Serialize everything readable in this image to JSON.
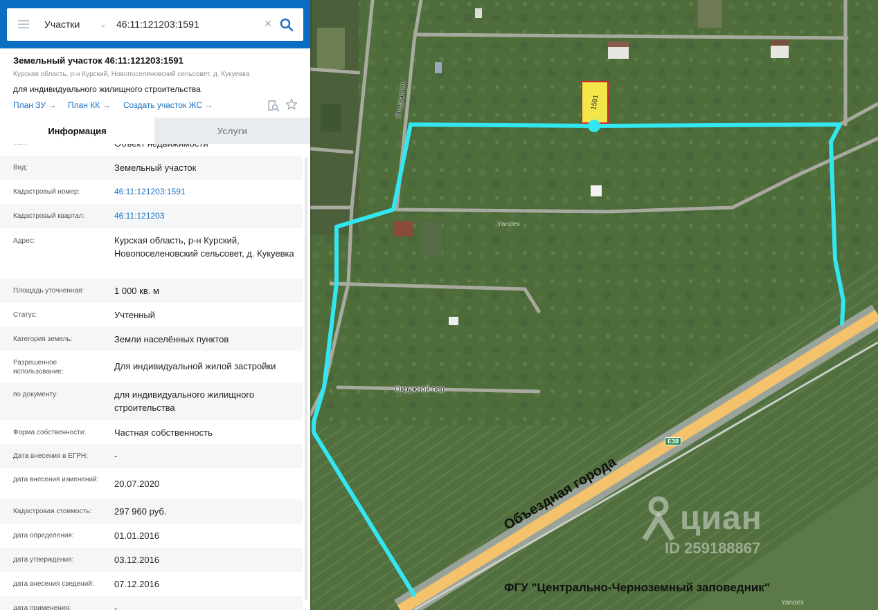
{
  "search": {
    "type_label": "Участки",
    "query": "46:11:121203:1591"
  },
  "parcel": {
    "title": "Земельный участок 46:11:121203:1591",
    "location": "Курская область, р-н Курский, Новопоселеновский сельсовет, д. Кукуевка",
    "purpose": "для индивидуального жилищного строительства",
    "links": [
      "План ЗУ →",
      "План КК →",
      "Создать участок ЖС →"
    ]
  },
  "tabs": {
    "info": "Информация",
    "services": "Услуги"
  },
  "info_rows": [
    {
      "label": "Тип:",
      "value": "Объект недвижимости"
    },
    {
      "label": "Вид:",
      "value": "Земельный участок"
    },
    {
      "label": "Кадастровый номер:",
      "value": "46:11:121203:1591"
    },
    {
      "label": "Кадастровый квартал:",
      "value": "46:11:121203"
    },
    {
      "label": "Адрес:",
      "value": "Курская область, р-н Курский, Новопоселеновский сельсовет, д. Кукуевка"
    },
    {
      "label": "Площадь уточненная:",
      "value": "1 000 кв. м"
    },
    {
      "label": "Статус:",
      "value": "Учтенный"
    },
    {
      "label": "Категория земель:",
      "value": "Земли населённых пунктов"
    },
    {
      "label": "Разрешенное использование:",
      "value": "Для индивидуальной жилой застройки"
    },
    {
      "label": "по документу:",
      "value": "для индивидуального жилищного строительства"
    },
    {
      "label": "Форма собственности:",
      "value": "Частная собственность"
    },
    {
      "label": "Дата внесения в ЕГРН:",
      "value": "-"
    },
    {
      "label": "дата внесения изменений:",
      "value": "20.07.2020"
    },
    {
      "label": "Кадастровая стоимость:",
      "value": "297 960 руб."
    },
    {
      "label": "дата определения:",
      "value": "01.01.2016"
    },
    {
      "label": "дата утверждения:",
      "value": "03.12.2016"
    },
    {
      "label": "дата внесения сведений:",
      "value": "07.12.2016"
    },
    {
      "label": "дата применения:",
      "value": "-"
    }
  ],
  "map": {
    "street_yagodnaya": "Ягодная ул.",
    "street_okruzhnoy": "Окружной пер.",
    "parcel_number": "1591",
    "yandex_1": "Yandex",
    "yandex_2": "Yandex",
    "highway_badge": "E38",
    "bypass_label": "Объездная города",
    "cian_logo": "циан",
    "cian_id": "ID 259188867",
    "reserve_label": "ФГУ \"Центрально-Черноземный заповедник\"",
    "route_color": "#33e6ef",
    "highway_color": "#f3c26b"
  }
}
